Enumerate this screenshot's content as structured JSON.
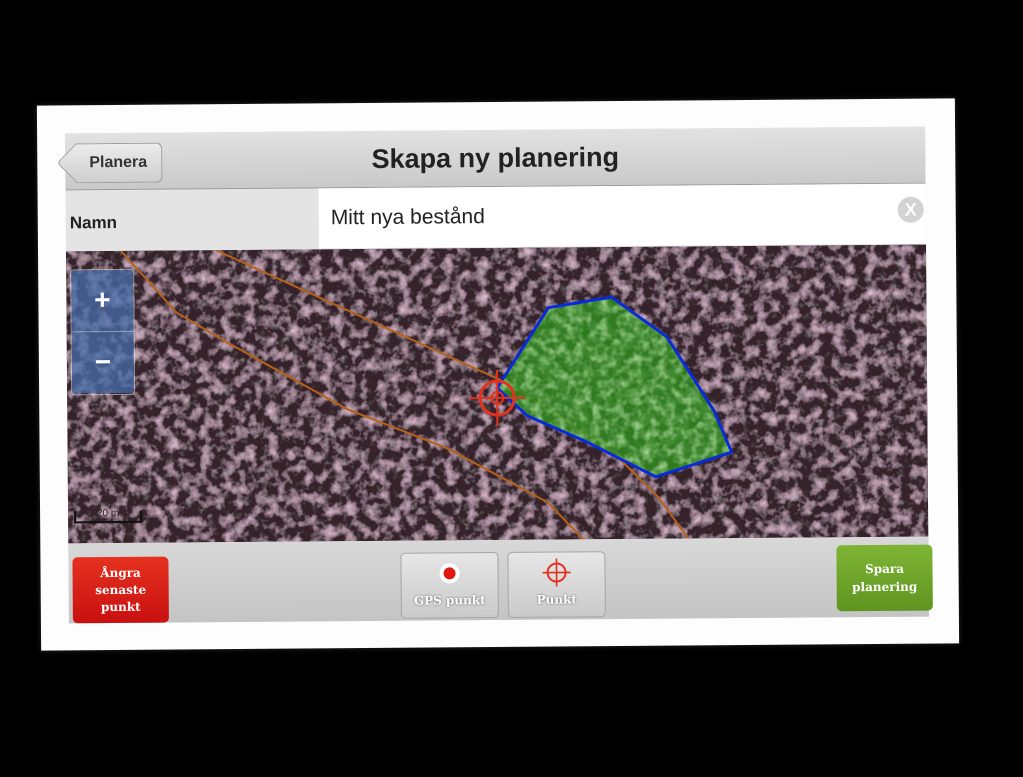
{
  "header": {
    "back_label": "Planera",
    "title": "Skapa ny planering"
  },
  "name_row": {
    "label": "Namn",
    "value": "Mitt nya bestånd",
    "clear_icon": "close-circle-icon",
    "clear_symbol": "X"
  },
  "map": {
    "zoom_in_label": "+",
    "zoom_out_label": "−",
    "scale_label": "20 m",
    "polygon_color": "#0a2bd9",
    "polygon_fill": "#3fa82a",
    "track_color": "#b5611a",
    "crosshair_color": "#e2321f"
  },
  "toolbar": {
    "undo_lines": [
      "Ångra",
      "senaste",
      "punkt"
    ],
    "gps_label": "GPS punkt",
    "point_label": "Punkt",
    "save_lines": [
      "Spara",
      "planering"
    ],
    "undo_color": "#d4211a",
    "save_color": "#6ea52b"
  }
}
